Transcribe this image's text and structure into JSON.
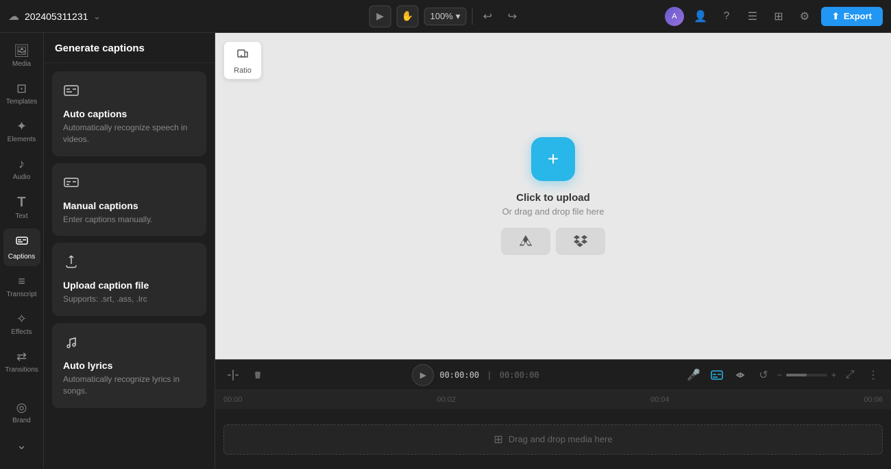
{
  "topbar": {
    "project_name": "202405311231",
    "zoom_level": "100%",
    "export_label": "Export",
    "cloud_icon": "☁",
    "dropdown_icon": "⌄"
  },
  "sidebar": {
    "items": [
      {
        "id": "media",
        "label": "Media",
        "icon": "⊞"
      },
      {
        "id": "templates",
        "label": "Templates",
        "icon": "⊡"
      },
      {
        "id": "elements",
        "label": "Elements",
        "icon": "✦"
      },
      {
        "id": "audio",
        "label": "Audio",
        "icon": "♪"
      },
      {
        "id": "text",
        "label": "Text",
        "icon": "T"
      },
      {
        "id": "captions",
        "label": "Captions",
        "icon": "⊟",
        "active": true
      },
      {
        "id": "transcript",
        "label": "Transcript",
        "icon": "≡"
      },
      {
        "id": "effects",
        "label": "Effects",
        "icon": "✧"
      },
      {
        "id": "transitions",
        "label": "Transitions",
        "icon": "⇄"
      }
    ],
    "bottom_items": [
      {
        "id": "brand",
        "label": "Brand",
        "icon": "◎"
      },
      {
        "id": "more",
        "label": "",
        "icon": "⌄"
      }
    ]
  },
  "panel": {
    "title": "Generate captions",
    "cards": [
      {
        "id": "auto-captions",
        "icon": "⊡",
        "title": "Auto captions",
        "description": "Automatically recognize speech in videos."
      },
      {
        "id": "manual-captions",
        "icon": "⊟",
        "title": "Manual captions",
        "description": "Enter captions manually."
      },
      {
        "id": "upload-caption",
        "icon": "⬆",
        "title": "Upload caption file",
        "description": "Supports: .srt, .ass, .lrc"
      },
      {
        "id": "auto-lyrics",
        "icon": "♫",
        "title": "Auto lyrics",
        "description": "Automatically recognize lyrics in songs."
      }
    ]
  },
  "canvas": {
    "ratio_label": "Ratio",
    "upload_main_text": "Click to upload",
    "upload_sub_text": "Or drag and drop file here",
    "upload_plus_icon": "+",
    "source_google_drive": "▲",
    "source_dropbox": "❐"
  },
  "timeline": {
    "current_time": "00:00:00",
    "total_time": "00:00:00",
    "ruler_marks": [
      "00:00",
      "00:02",
      "00:04",
      "00:06"
    ],
    "drop_zone_text": "Drag and drop media here",
    "drop_zone_icon": "⊞"
  }
}
